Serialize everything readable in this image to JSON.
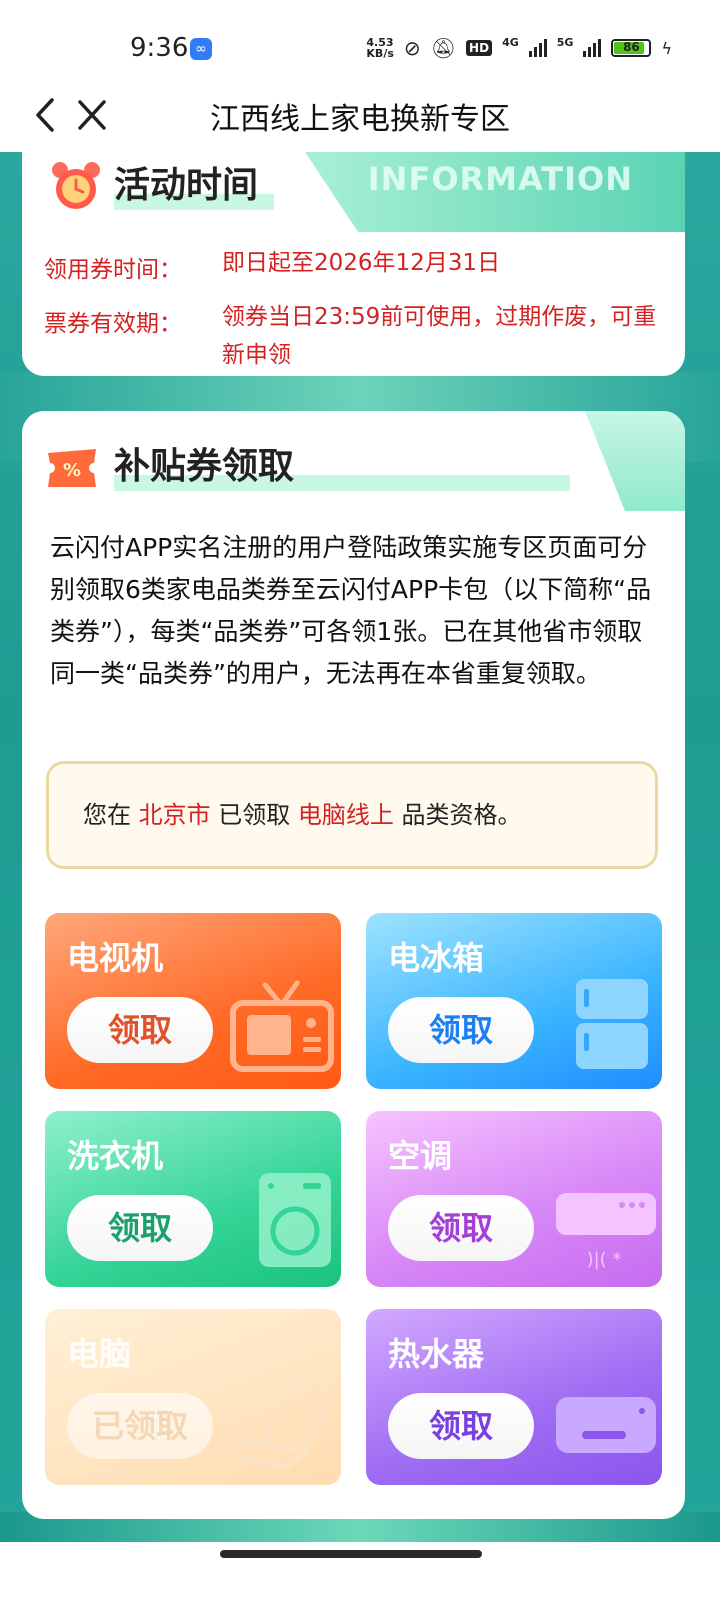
{
  "status_bar": {
    "time": "9:36",
    "speed_value": "4.53",
    "speed_unit": "KB/s",
    "hd_label": "HD",
    "net_4g": "4G",
    "net_5g": "5G",
    "battery": "86",
    "icons": [
      "link-icon",
      "mute-icon",
      "signal-icon",
      "charging-icon"
    ]
  },
  "nav": {
    "title": "江西线上家电换新专区"
  },
  "activity": {
    "title": "活动时间",
    "watermark": "INFORMATION",
    "rows": [
      {
        "label": "领用券时间：",
        "value": "即日起至2026年12月31日"
      },
      {
        "label": "票券有效期：",
        "value": "领券当日23:59前可使用，过期作废，可重新申领"
      }
    ]
  },
  "subsidy": {
    "title": "补贴券领取",
    "description": "云闪付APP实名注册的用户登陆政策实施专区页面可分别领取6类家电品类券至云闪付APP卡包（以下简称“品类券”），每类“品类券”可各领1张。已在其他省市领取同一类“品类券”的用户，无法再在本省重复领取。",
    "notice": {
      "prefix": "您在 ",
      "city": "北京市",
      "middle": " 已领取 ",
      "category": "电脑线上",
      "suffix": " 品类资格。"
    },
    "tiles": [
      {
        "name": "电视机",
        "button": "领取"
      },
      {
        "name": "电冰箱",
        "button": "领取"
      },
      {
        "name": "洗衣机",
        "button": "领取"
      },
      {
        "name": "空调",
        "button": "领取"
      },
      {
        "name": "电脑",
        "button": "已领取"
      },
      {
        "name": "热水器",
        "button": "领取"
      }
    ]
  },
  "colors": {
    "accent_red": "#d42222",
    "teal_bg": "#1d9d92"
  }
}
